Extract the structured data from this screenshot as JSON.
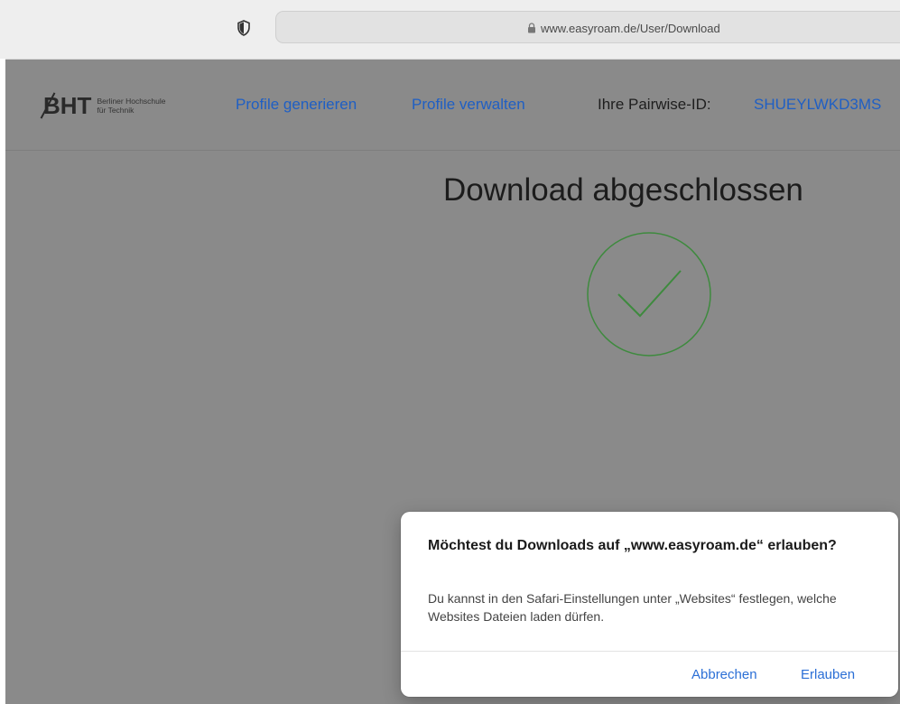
{
  "browser": {
    "url": "www.easyroam.de/User/Download"
  },
  "header": {
    "logo": {
      "mark": "BHT",
      "line1": "Berliner Hochschule",
      "line2": "für Technik"
    },
    "nav": {
      "generate": "Profile generieren",
      "manage": "Profile verwalten",
      "pairwise_label": "Ihre Pairwise-ID:",
      "pairwise_value": "SHUEYLWKD3MS"
    }
  },
  "main": {
    "title": "Download abgeschlossen",
    "check_icon": "checkmark-circle-icon"
  },
  "dialog": {
    "title": "Möchtest du Downloads auf „www.easyroam.de“ erlauben?",
    "body": "Du kannst in den Safari-Einstellungen unter „Websites“ festlegen, welche Websites Dateien laden dürfen.",
    "cancel": "Abbrechen",
    "allow": "Erlauben"
  },
  "colors": {
    "link": "#1f5fc4",
    "check": "#3e8a3e",
    "dialog_button": "#2b6fd6"
  }
}
